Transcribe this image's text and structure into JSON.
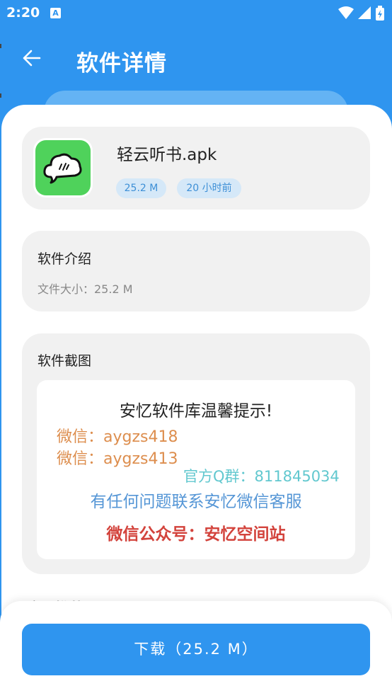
{
  "status_bar": {
    "time": "2:20",
    "notification_glyph": "A"
  },
  "header": {
    "title": "软件详情"
  },
  "app": {
    "name": "轻云听书.apk",
    "size_tag": "25.2 M",
    "time_tag": "20 小时前",
    "icon_color": "#4fd25b"
  },
  "intro": {
    "title": "软件介绍",
    "size_text": "文件大小：25.2 M"
  },
  "screenshots": {
    "title": "软件截图",
    "image": {
      "heading": "安忆软件库温馨提示!",
      "wechat1": "微信：aygzs418",
      "wechat2": "微信：aygzs413",
      "qq_group": "官方Q群：811845034",
      "contact": "有任何问题联系安忆微信客服",
      "official_account": "微信公众号：安忆空间站"
    }
  },
  "more": {
    "title": "应用推荐"
  },
  "download": {
    "label": "下载（25.2 M）"
  },
  "colors": {
    "primary": "#2f95ef",
    "card_bg": "#f1f1f1",
    "tag_bg": "#d5e8f8",
    "tag_text": "#3d8fd6"
  }
}
